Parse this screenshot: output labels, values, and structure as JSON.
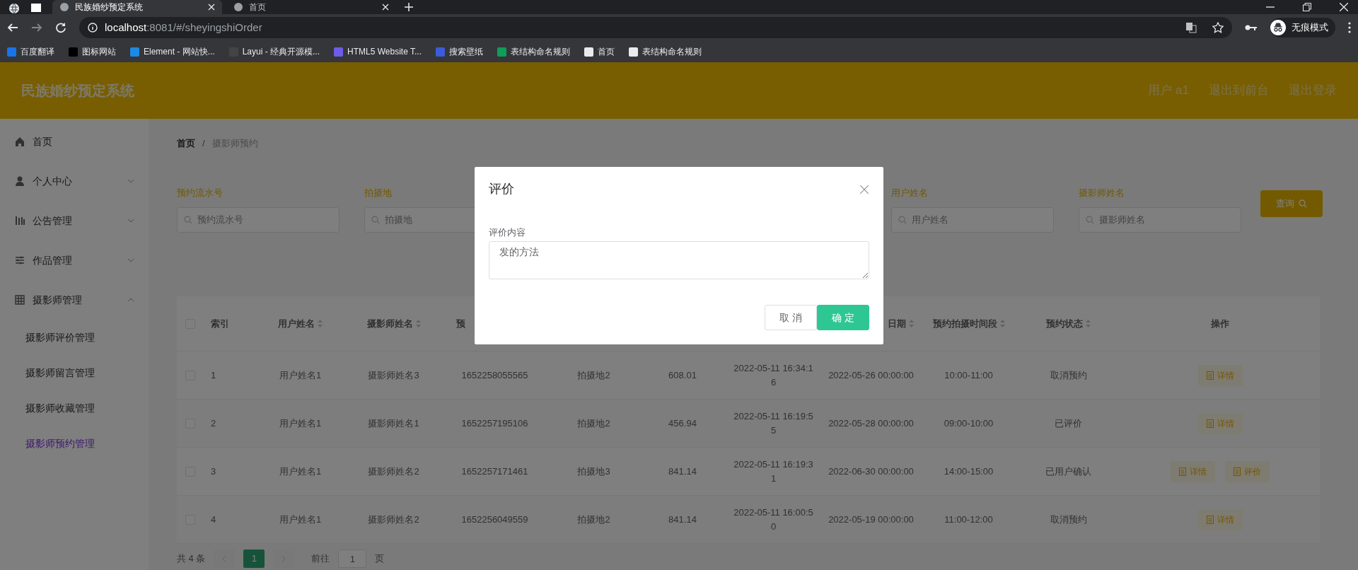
{
  "browser": {
    "tabs": [
      {
        "title": "民族婚纱预定系统",
        "selected": true
      },
      {
        "title": "首页",
        "selected": false
      }
    ],
    "url_host": "localhost",
    "url_rest": ":8081/#/sheyingshiOrder",
    "profile": "无痕模式",
    "bookmarks": [
      "百度翻译",
      "图标网站",
      "Element - 网站快...",
      "Layui - 经典开源模...",
      "HTML5 Website T...",
      "搜索壁纸",
      "表结构命名规则",
      "首页",
      "表结构命名规则"
    ]
  },
  "app": {
    "title": "民族婚纱预定系统",
    "header_links": [
      "用户 a1",
      "退出到前台",
      "退出登录"
    ]
  },
  "sidebar": [
    {
      "label": "首页"
    },
    {
      "label": "个人中心",
      "expanded": false
    },
    {
      "label": "公告管理",
      "expanded": false
    },
    {
      "label": "作品管理",
      "expanded": false
    },
    {
      "label": "摄影师管理",
      "expanded": true,
      "children": [
        {
          "label": "摄影师评价管理",
          "selected": false
        },
        {
          "label": "摄影师留言管理",
          "selected": false
        },
        {
          "label": "摄影师收藏管理",
          "selected": false
        },
        {
          "label": "摄影师预约管理",
          "selected": true
        }
      ]
    }
  ],
  "breadcrumb": [
    "首页",
    "摄影师预约"
  ],
  "breadcrumb_separator": "/",
  "search_fields": [
    {
      "label": "预约流水号",
      "placeholder": "预约流水号"
    },
    {
      "label": "拍摄地",
      "placeholder": "拍摄地"
    },
    {
      "label": "用户姓名",
      "placeholder": "用户姓名"
    },
    {
      "label": "摄影师姓名",
      "placeholder": "摄影师姓名"
    }
  ],
  "search_button": "查询",
  "table": {
    "select_all_checked": false,
    "columns": [
      {
        "text": "索引",
        "sortable": false
      },
      {
        "text": "用户姓名",
        "sortable": true
      },
      {
        "text": "摄影师姓名",
        "sortable": true
      },
      {
        "text": "预",
        "sortable": false
      }
    ],
    "columns_right": [
      {
        "text": "日期",
        "sortable": true
      },
      {
        "text": "预约拍摄时间段",
        "sortable": true
      },
      {
        "text": "预约状态",
        "sortable": true
      },
      {
        "text": "操作",
        "sortable": false
      }
    ],
    "rows": [
      {
        "cells": [
          "1",
          "用户姓名1",
          "摄影师姓名3",
          "1652258055565",
          "拍摄地2",
          "608.01",
          "2022-05-11 16:34:16",
          "2022-05-26 00:00:00",
          "10:00-11:00",
          "取消预约"
        ],
        "checked": false,
        "actions": [
          "详情"
        ]
      },
      {
        "cells": [
          "2",
          "用户姓名1",
          "摄影师姓名1",
          "1652257195106",
          "拍摄地2",
          "456.94",
          "2022-05-11 16:19:55",
          "2022-05-28 00:00:00",
          "09:00-10:00",
          "已评价"
        ],
        "checked": false,
        "actions": [
          "详情"
        ]
      },
      {
        "cells": [
          "3",
          "用户姓名1",
          "摄影师姓名2",
          "1652257171461",
          "拍摄地3",
          "841.14",
          "2022-05-11 16:19:31",
          "2022-06-30 00:00:00",
          "14:00-15:00",
          "已用户确认"
        ],
        "checked": false,
        "actions": [
          "详情",
          "评价"
        ]
      },
      {
        "cells": [
          "4",
          "用户姓名1",
          "摄影师姓名2",
          "1652256049559",
          "拍摄地2",
          "841.14",
          "2022-05-11 16:00:50",
          "2022-05-19 00:00:00",
          "11:00-12:00",
          "取消预约"
        ],
        "checked": false,
        "actions": [
          "详情"
        ]
      }
    ]
  },
  "pagination": {
    "total": "共 4 条",
    "pages": [
      {
        "label": "1",
        "selected": true
      }
    ],
    "goto_label": "前往",
    "goto_value": "1",
    "goto_suffix": "页"
  },
  "dialog": {
    "title": "评价",
    "field_label": "评价内容",
    "field_value": "发的方法",
    "buttons": [
      {
        "label": "取 消",
        "kind": "default"
      },
      {
        "label": "确 定",
        "kind": "primary"
      }
    ]
  }
}
